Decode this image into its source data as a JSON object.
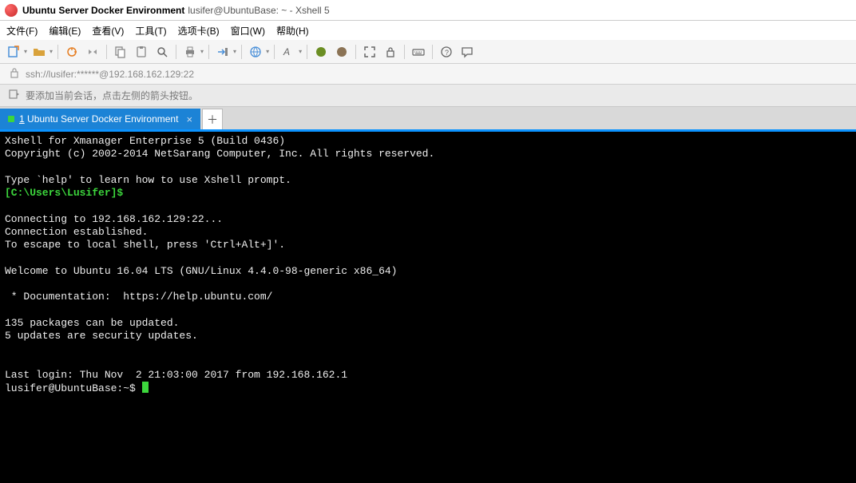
{
  "title": {
    "bold": "Ubuntu Server Docker Environment",
    "rest": "lusifer@UbuntuBase: ~ - Xshell 5"
  },
  "menu": {
    "file": "文件(F)",
    "edit": "编辑(E)",
    "view": "查看(V)",
    "tool": "工具(T)",
    "tab": "选项卡(B)",
    "window": "窗口(W)",
    "help": "帮助(H)"
  },
  "address": {
    "url": "ssh://lusifer:******@192.168.162.129:22"
  },
  "hint": {
    "text": "要添加当前会话，点击左侧的箭头按钮。"
  },
  "tab": {
    "label": "1 Ubuntu Server Docker Environment",
    "underline_num": "1"
  },
  "term": {
    "l1": "Xshell for Xmanager Enterprise 5 (Build 0436)",
    "l2": "Copyright (c) 2002-2014 NetSarang Computer, Inc. All rights reserved.",
    "l3": "",
    "l4": "Type `help' to learn how to use Xshell prompt.",
    "l5": "[C:\\Users\\Lusifer]$",
    "l6": "",
    "l7": "Connecting to 192.168.162.129:22...",
    "l8": "Connection established.",
    "l9": "To escape to local shell, press 'Ctrl+Alt+]'.",
    "l10": "",
    "l11": "Welcome to Ubuntu 16.04 LTS (GNU/Linux 4.4.0-98-generic x86_64)",
    "l12": "",
    "l13": " * Documentation:  https://help.ubuntu.com/",
    "l14": "",
    "l15": "135 packages can be updated.",
    "l16": "5 updates are security updates.",
    "l17": "",
    "l18": "",
    "l19": "Last login: Thu Nov  2 21:03:00 2017 from 192.168.162.1",
    "l20": "lusifer@UbuntuBase:~$ "
  }
}
